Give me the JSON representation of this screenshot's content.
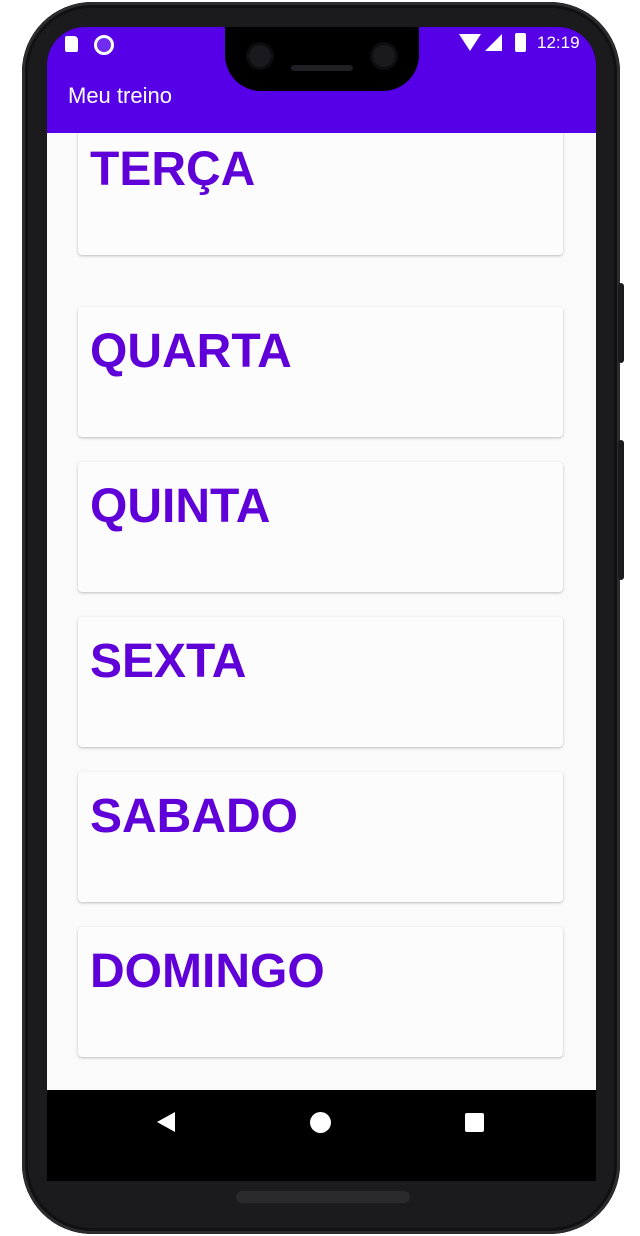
{
  "status_bar": {
    "time": "12:19",
    "icons": [
      "sd-card-icon",
      "sync-icon",
      "wifi-icon",
      "signal-icon",
      "battery-icon"
    ]
  },
  "app_bar": {
    "title": "Meu treino"
  },
  "days": [
    {
      "label": "TERÇA"
    },
    {
      "label": "QUARTA"
    },
    {
      "label": "QUINTA"
    },
    {
      "label": "SEXTA"
    },
    {
      "label": "SABADO"
    },
    {
      "label": "DOMINGO"
    }
  ],
  "nav_bar": {
    "icons": [
      "back-icon",
      "home-icon",
      "recents-icon"
    ]
  },
  "colors": {
    "primary": "#5600e8",
    "card_text": "#5f00d8",
    "background": "#fafafa",
    "card": "#fcfcfc"
  }
}
